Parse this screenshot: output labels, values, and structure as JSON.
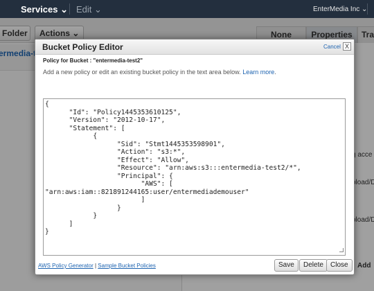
{
  "topnav": {
    "services": "Services ⌄",
    "edit": "Edit ⌄",
    "account": "EnterMedia Inc ⌄"
  },
  "toolbar": {
    "folder_label": "Folder",
    "actions_label": "Actions ⌄"
  },
  "tabs": {
    "none": "None",
    "properties": "Properties",
    "transfers": "Tra"
  },
  "breadcrumb": "ermedia-tes",
  "background_text": [
    "g acce",
    "pload/D",
    "pload/D"
  ],
  "background_add": "Add",
  "modal": {
    "title": "Bucket Policy Editor",
    "cancel": "Cancel",
    "close_x": "X",
    "subtitle": "Policy for Bucket : \"entermedia-test2\"",
    "intro": "Add a new policy or edit an existing bucket policy in the text area below.",
    "learn_more": "Learn more",
    "policy_text": "{\n\t\"Id\": \"Policy1445353610125\",\n\t\"Version\": \"2012-10-17\",\n\t\"Statement\": [\n\t\t{\n\t\t\t\"Sid\": \"Stmt1445353598901\",\n\t\t\t\"Action\": \"s3:*\",\n\t\t\t\"Effect\": \"Allow\",\n\t\t\t\"Resource\": \"arn:aws:s3:::entermedia-test2/*\",\n\t\t\t\"Principal\": {\n\t\t\t\t\"AWS\": [\n\"arn:aws:iam::821891244165:user/entermediademouser\"\n\t\t\t\t]\n\t\t\t}\n\t\t}\n\t]\n}",
    "footer": {
      "generator_link": "AWS Policy Generator",
      "separator": "|",
      "sample_link": "Sample Bucket Policies",
      "save": "Save",
      "delete": "Delete",
      "close": "Close"
    }
  }
}
